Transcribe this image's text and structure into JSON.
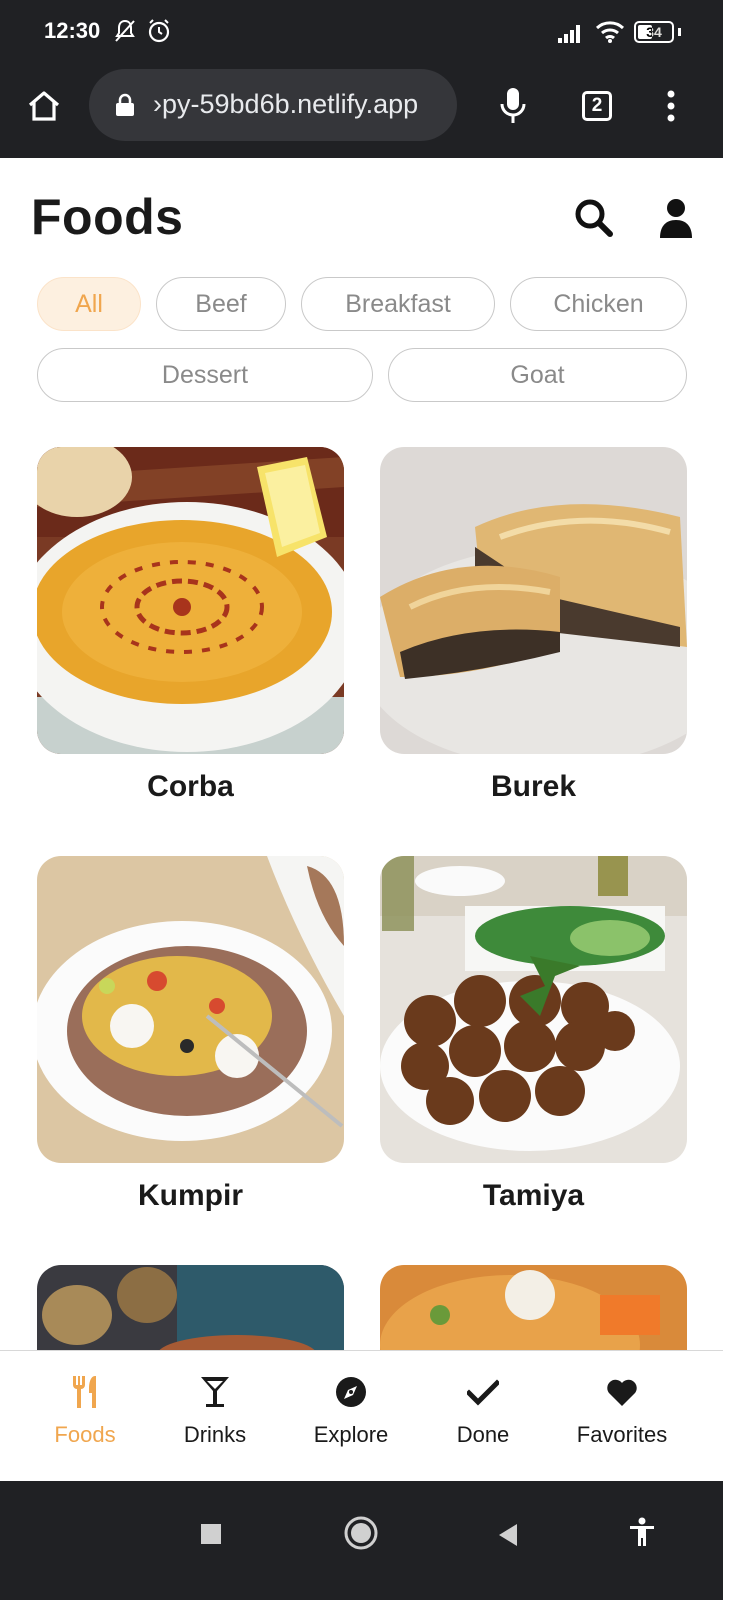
{
  "status": {
    "time": "12:30",
    "battery": "34"
  },
  "browser": {
    "url": "›py-59bd6b.netlify.app",
    "tab_count": "2"
  },
  "page": {
    "title": "Foods"
  },
  "filters": [
    "All",
    "Beef",
    "Breakfast",
    "Chicken",
    "Dessert",
    "Goat"
  ],
  "active_filter": "All",
  "foods": [
    {
      "name": "Corba"
    },
    {
      "name": "Burek"
    },
    {
      "name": "Kumpir"
    },
    {
      "name": "Tamiya"
    }
  ],
  "nav": [
    {
      "label": "Foods",
      "icon": "utensils-icon",
      "active": true
    },
    {
      "label": "Drinks",
      "icon": "cocktail-icon"
    },
    {
      "label": "Explore",
      "icon": "compass-icon"
    },
    {
      "label": "Done",
      "icon": "check-icon"
    },
    {
      "label": "Favorites",
      "icon": "heart-icon"
    }
  ],
  "colors": {
    "accent": "#f0a64e",
    "dark_bar": "#202124",
    "url_pill": "#35363a"
  }
}
